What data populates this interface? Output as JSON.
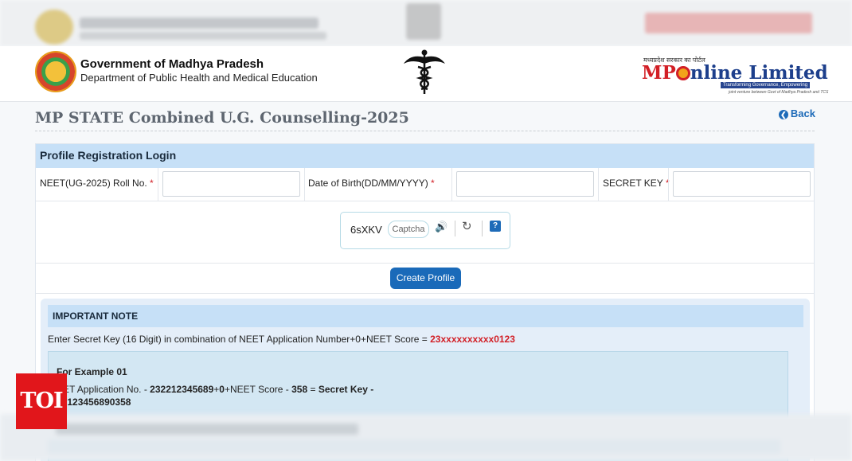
{
  "header": {
    "gov_title": "Government of Madhya Pradesh",
    "gov_subtitle": "Department of Public Health and Medical Education",
    "mp_small_text": "मध्यप्रदेश सरकार का पोर्टल",
    "mp_logo_prefix": "MP",
    "mp_logo_suffix": "nline Limited",
    "mp_tagline": "Transforming Governance, Empowering Citizens",
    "mp_tagline2": "joint venture between Govt of Madhya Pradesh and TCS"
  },
  "page": {
    "title": "MP STATE Combined U.G. Counselling-2025",
    "back_label": "Back"
  },
  "form": {
    "heading": "Profile Registration Login",
    "roll_label": "NEET(UG-2025) Roll No.",
    "dob_label": "Date of Birth(DD/MM/YYYY)",
    "secret_label": "SECRET KEY",
    "required_mark": "*",
    "roll_value": "",
    "dob_value": "",
    "secret_value": ""
  },
  "captcha": {
    "code": "6sXKV",
    "placeholder": "Captcha",
    "help": "?"
  },
  "buttons": {
    "create_profile": "Create Profile"
  },
  "note": {
    "heading": "IMPORTANT NOTE",
    "text": "Enter Secret Key (16 Digit) in combination of NEET Application Number+0+NEET Score = ",
    "text_highlight": "23xxxxxxxxxx0123",
    "example_title": "For Example 01",
    "example_line1_a": "EET Application No. - ",
    "example_line1_b": "232212345689",
    "example_line1_c": "+",
    "example_line1_d": "0",
    "example_line1_e": "+NEET Score - ",
    "example_line1_f": "358",
    "example_line1_g": " = ",
    "example_line1_h": "Secret Key -",
    "example_line2": "22123456890358"
  },
  "watermark": {
    "label": "TOI"
  },
  "colors": {
    "accent": "#1a6ab9",
    "panel_head": "#c6e0f7",
    "required": "#d21f26",
    "toi": "#e1161b"
  }
}
